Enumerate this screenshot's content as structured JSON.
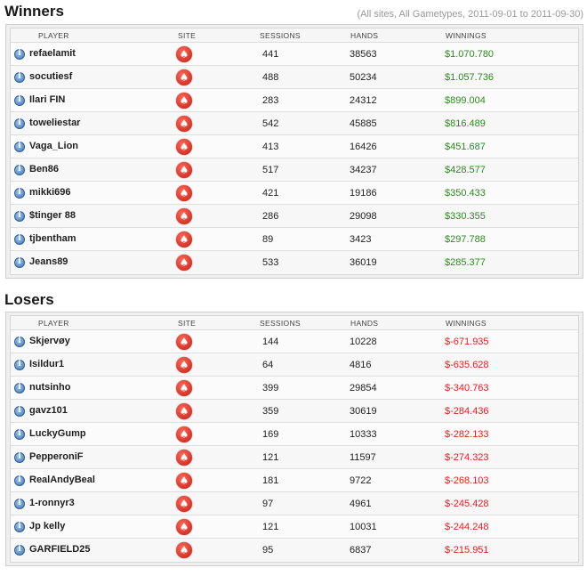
{
  "winners": {
    "title": "Winners",
    "subtitle": "(All sites, All Gametypes, 2011-09-01 to 2011-09-30)",
    "columns": {
      "player": "PLAYER",
      "site": "SITE",
      "sessions": "SESSIONS",
      "hands": "HANDS",
      "winnings": "WINNINGS"
    },
    "rows": [
      {
        "player": "refaelamit",
        "sessions": "441",
        "hands": "38563",
        "winnings": "$1.070.780"
      },
      {
        "player": "socutiesf",
        "sessions": "488",
        "hands": "50234",
        "winnings": "$1.057.736"
      },
      {
        "player": "Ilari FIN",
        "sessions": "283",
        "hands": "24312",
        "winnings": "$899.004"
      },
      {
        "player": "toweliestar",
        "sessions": "542",
        "hands": "45885",
        "winnings": "$816.489"
      },
      {
        "player": "Vaga_Lion",
        "sessions": "413",
        "hands": "16426",
        "winnings": "$451.687"
      },
      {
        "player": "Ben86",
        "sessions": "517",
        "hands": "34237",
        "winnings": "$428.577"
      },
      {
        "player": "mikki696",
        "sessions": "421",
        "hands": "19186",
        "winnings": "$350.433"
      },
      {
        "player": "$tinger 88",
        "sessions": "286",
        "hands": "29098",
        "winnings": "$330.355"
      },
      {
        "player": "tjbentham",
        "sessions": "89",
        "hands": "3423",
        "winnings": "$297.788"
      },
      {
        "player": "Jeans89",
        "sessions": "533",
        "hands": "36019",
        "winnings": "$285.377"
      }
    ]
  },
  "losers": {
    "title": "Losers",
    "columns": {
      "player": "PLAYER",
      "site": "SITE",
      "sessions": "SESSIONS",
      "hands": "HANDS",
      "winnings": "WINNINGS"
    },
    "rows": [
      {
        "player": "Skjervøy",
        "sessions": "144",
        "hands": "10228",
        "winnings": "$-671.935"
      },
      {
        "player": "Isildur1",
        "sessions": "64",
        "hands": "4816",
        "winnings": "$-635.628"
      },
      {
        "player": "nutsinho",
        "sessions": "399",
        "hands": "29854",
        "winnings": "$-340.763"
      },
      {
        "player": "gavz101",
        "sessions": "359",
        "hands": "30619",
        "winnings": "$-284.436"
      },
      {
        "player": "LuckyGump",
        "sessions": "169",
        "hands": "10333",
        "winnings": "$-282.133"
      },
      {
        "player": "PepperoniF",
        "sessions": "121",
        "hands": "11597",
        "winnings": "$-274.323"
      },
      {
        "player": "RealAndyBeal",
        "sessions": "181",
        "hands": "9722",
        "winnings": "$-268.103"
      },
      {
        "player": "1-ronnyr3",
        "sessions": "97",
        "hands": "4961",
        "winnings": "$-245.428"
      },
      {
        "player": "Jp kelly",
        "sessions": "121",
        "hands": "10031",
        "winnings": "$-244.248"
      },
      {
        "player": "GARFIELD25",
        "sessions": "95",
        "hands": "6837",
        "winnings": "$-215.951"
      }
    ]
  },
  "icons": {
    "info": "info-icon",
    "site": "pokerstars-spade-icon"
  },
  "colors": {
    "positive": "#2d8a1e",
    "negative": "#e02020"
  }
}
